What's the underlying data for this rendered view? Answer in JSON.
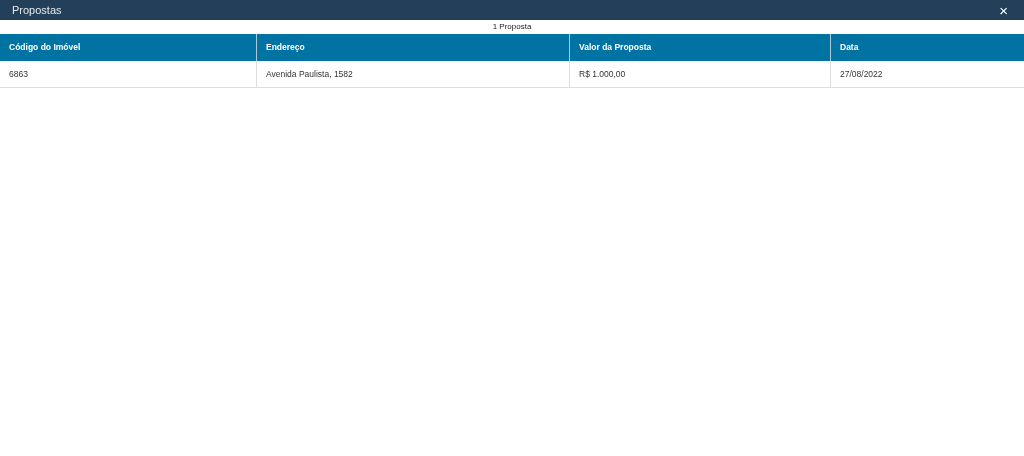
{
  "window": {
    "title": "Propostas",
    "close": "×"
  },
  "count": "1 Proposta",
  "table": {
    "columns": [
      "Código do Imóvel",
      "Endereço",
      "Valor da Proposta",
      "Data"
    ],
    "rows": [
      [
        "6863",
        "Avenida Paulista, 1582",
        "R$ 1.000,00",
        "27/08/2022"
      ]
    ]
  }
}
